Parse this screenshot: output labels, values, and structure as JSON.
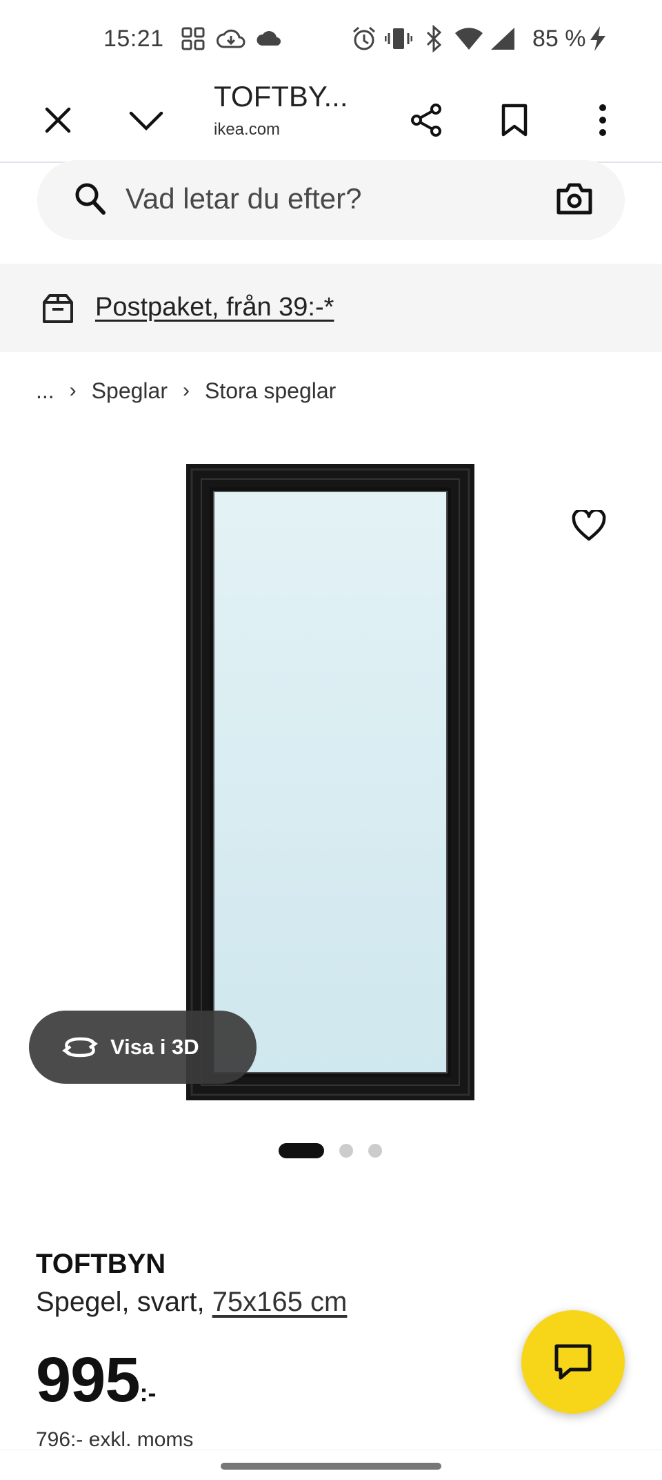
{
  "status_bar": {
    "time": "15:21",
    "battery_text": "85 %",
    "icons": [
      "apps-icon",
      "cloud-sync-icon",
      "cloud-icon",
      "alarm-icon",
      "vibrate-icon",
      "bluetooth-icon",
      "wifi-icon",
      "signal-icon",
      "charging-icon"
    ]
  },
  "browser": {
    "title": "TOFTBY...",
    "domain": "ikea.com"
  },
  "search": {
    "placeholder": "Vad letar du efter?"
  },
  "banner": {
    "text": "Postpaket, från 39:-*"
  },
  "breadcrumb": {
    "ellipsis": "...",
    "items": [
      "Speglar",
      "Stora speglar"
    ]
  },
  "gallery": {
    "view_3d_label": "Visa i 3D",
    "image_count": 3,
    "active_index": 0
  },
  "product": {
    "name": "TOFTBYN",
    "description": "Spegel, svart, ",
    "size": "75x165 cm",
    "price": "995",
    "price_suffix": ":-",
    "price_ex_vat": "796:- exkl. moms"
  },
  "colors": {
    "accent_yellow": "#f7d61a",
    "frame_black": "#1b1b1b",
    "glass": "#d7ecf1"
  }
}
